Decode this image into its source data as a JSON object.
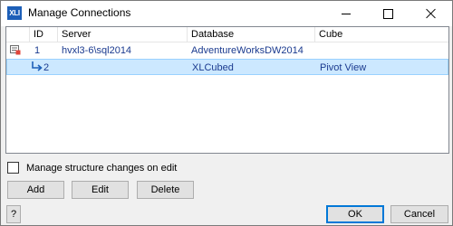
{
  "window": {
    "icon_text": "XLI",
    "title": "Manage Connections"
  },
  "grid": {
    "columns": [
      "ID",
      "Server",
      "Database",
      "Cube"
    ],
    "rows": [
      {
        "id": "1",
        "server": "hvxl3-6\\sql2014",
        "database": "AdventureWorksDW2014",
        "cube": "",
        "selected": false,
        "child": false
      },
      {
        "id": "2",
        "server": "",
        "database": "XLCubed",
        "cube": "Pivot View",
        "selected": true,
        "child": true
      }
    ]
  },
  "options": {
    "manage_structure_label": "Manage structure changes on edit",
    "manage_structure_checked": false
  },
  "buttons": {
    "add": "Add",
    "edit": "Edit",
    "delete": "Delete",
    "help": "?",
    "ok": "OK",
    "cancel": "Cancel"
  },
  "icons": {
    "connection": "connection-icon",
    "child": "child-arrow-icon"
  },
  "colors": {
    "selection": "#cce8ff",
    "link_text": "#1a3a8f",
    "accent": "#0078d7"
  }
}
